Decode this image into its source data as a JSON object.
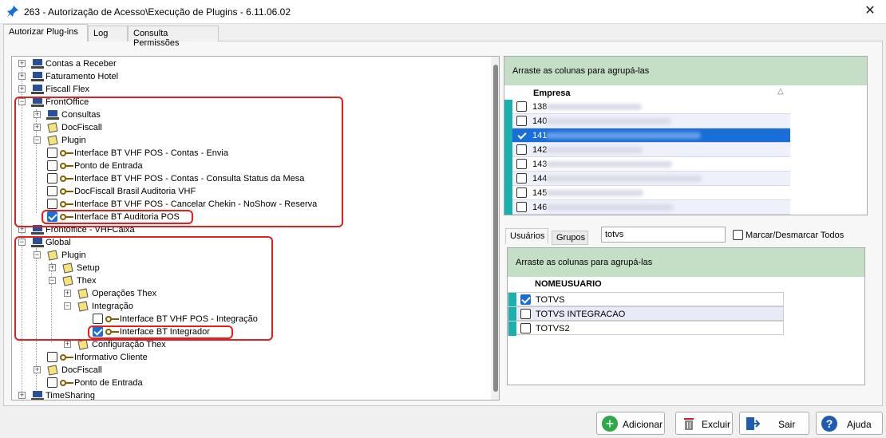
{
  "window": {
    "title": "263 - Autorização de Acesso\\Execução de Plugins - 6.11.06.02"
  },
  "tabs": [
    "Autorizar Plug-ins",
    "Log",
    "Consulta Permissões"
  ],
  "tree": {
    "items": [
      "Contas a Receber",
      "Faturamento Hotel",
      "Fiscall Flex",
      "FrontOffice",
      "Consultas",
      "DocFiscall",
      "Plugin",
      "Interface BT VHF POS - Contas - Envia",
      "Ponto de Entrada",
      "Interface BT VHF POS - Contas - Consulta Status da Mesa",
      "DocFiscall Brasil Auditoria VHF",
      "Interface BT VHF POS - Cancelar Chekin - NoShow - Reserva",
      "Interface BT Auditoria POS",
      "Frontoffice - VHFCaixa",
      "Global",
      "Plugin",
      "Setup",
      "Thex",
      "Operações Thex",
      "Integração",
      "Interface BT VHF POS - Integração",
      "Interface BT Integrador",
      "Configuração Thex",
      "Informativo Cliente",
      "DocFiscall",
      "Ponto de Entrada",
      "TimeSharing"
    ]
  },
  "empresa_grid": {
    "group_hint": "Arraste as colunas para agrupá-las",
    "column": "Empresa",
    "rows": [
      "138",
      "140",
      "141",
      "142",
      "143",
      "144",
      "145",
      "146"
    ]
  },
  "sub_tabs": [
    "Usuários",
    "Grupos"
  ],
  "search": {
    "value": "totvs"
  },
  "select_all": {
    "label": "Marcar/Desmarcar Todos"
  },
  "user_grid": {
    "group_hint": "Arraste as colunas para agrupá-las",
    "column": "NOMEUSUARIO",
    "rows": [
      "TOTVS",
      "TOTVS INTEGRACAO",
      "TOTVS2"
    ]
  },
  "buttons": {
    "add": "Adicionar",
    "delete": "Excluir",
    "exit": "Sair",
    "help": "Ajuda"
  },
  "colors": {
    "accent": "#1a6ed8",
    "teal": "#1ab0b0",
    "group_header": "#c4dfc6",
    "highlight": "#e02020"
  }
}
